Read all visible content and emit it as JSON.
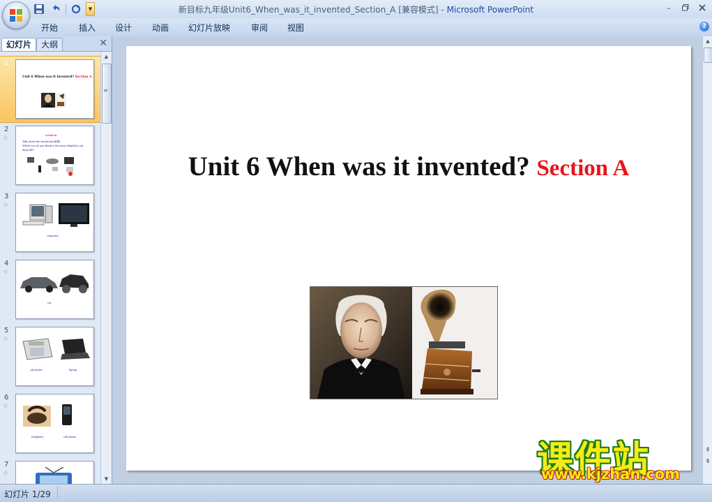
{
  "window": {
    "title_prefix": "新目标九年级Unit6_When_was_it_invented_Section_A [兼容模式] - ",
    "app_name": "Microsoft PowerPoint",
    "minimize_glyph": "–"
  },
  "ribbon": {
    "tabs": [
      "开始",
      "插入",
      "设计",
      "动画",
      "幻灯片放映",
      "审阅",
      "视图"
    ],
    "help_glyph": "?"
  },
  "left_pane": {
    "tab_slides": "幻灯片",
    "tab_outline": "大纲",
    "close_glyph": "✕",
    "scroll_glyph": "≡",
    "thumbs": [
      {
        "num": "1",
        "title": "Unit 6   When was it invented?",
        "section": "Section A"
      },
      {
        "num": "2",
        "star": "☆",
        "heading": "Lead in",
        "line1": "Talk about the inventions(发明)",
        "line2": "Which one do you think is the most helpful in our",
        "line3": "daily life?"
      },
      {
        "num": "3",
        "star": "☆",
        "caption": "computer"
      },
      {
        "num": "4",
        "star": "☆",
        "caption": "car"
      },
      {
        "num": "5",
        "star": "☆",
        "caption1": "calculator",
        "caption2": "laptop"
      },
      {
        "num": "6",
        "star": "☆",
        "caption1": "telephone",
        "caption2": "cell phone"
      },
      {
        "num": "7",
        "star": "☆"
      }
    ]
  },
  "slide": {
    "title_main": "Unit 6   When was it invented? ",
    "title_section": "Section A"
  },
  "status": {
    "slide_counter": "幻灯片 1/29"
  },
  "watermark": {
    "brand_cn": "课件站",
    "url": "www.kjzhan.com"
  },
  "colors": {
    "accent_red": "#e8141b",
    "selected_thumb": "#f9c564",
    "ribbon_blue": "#c3d5ee"
  }
}
